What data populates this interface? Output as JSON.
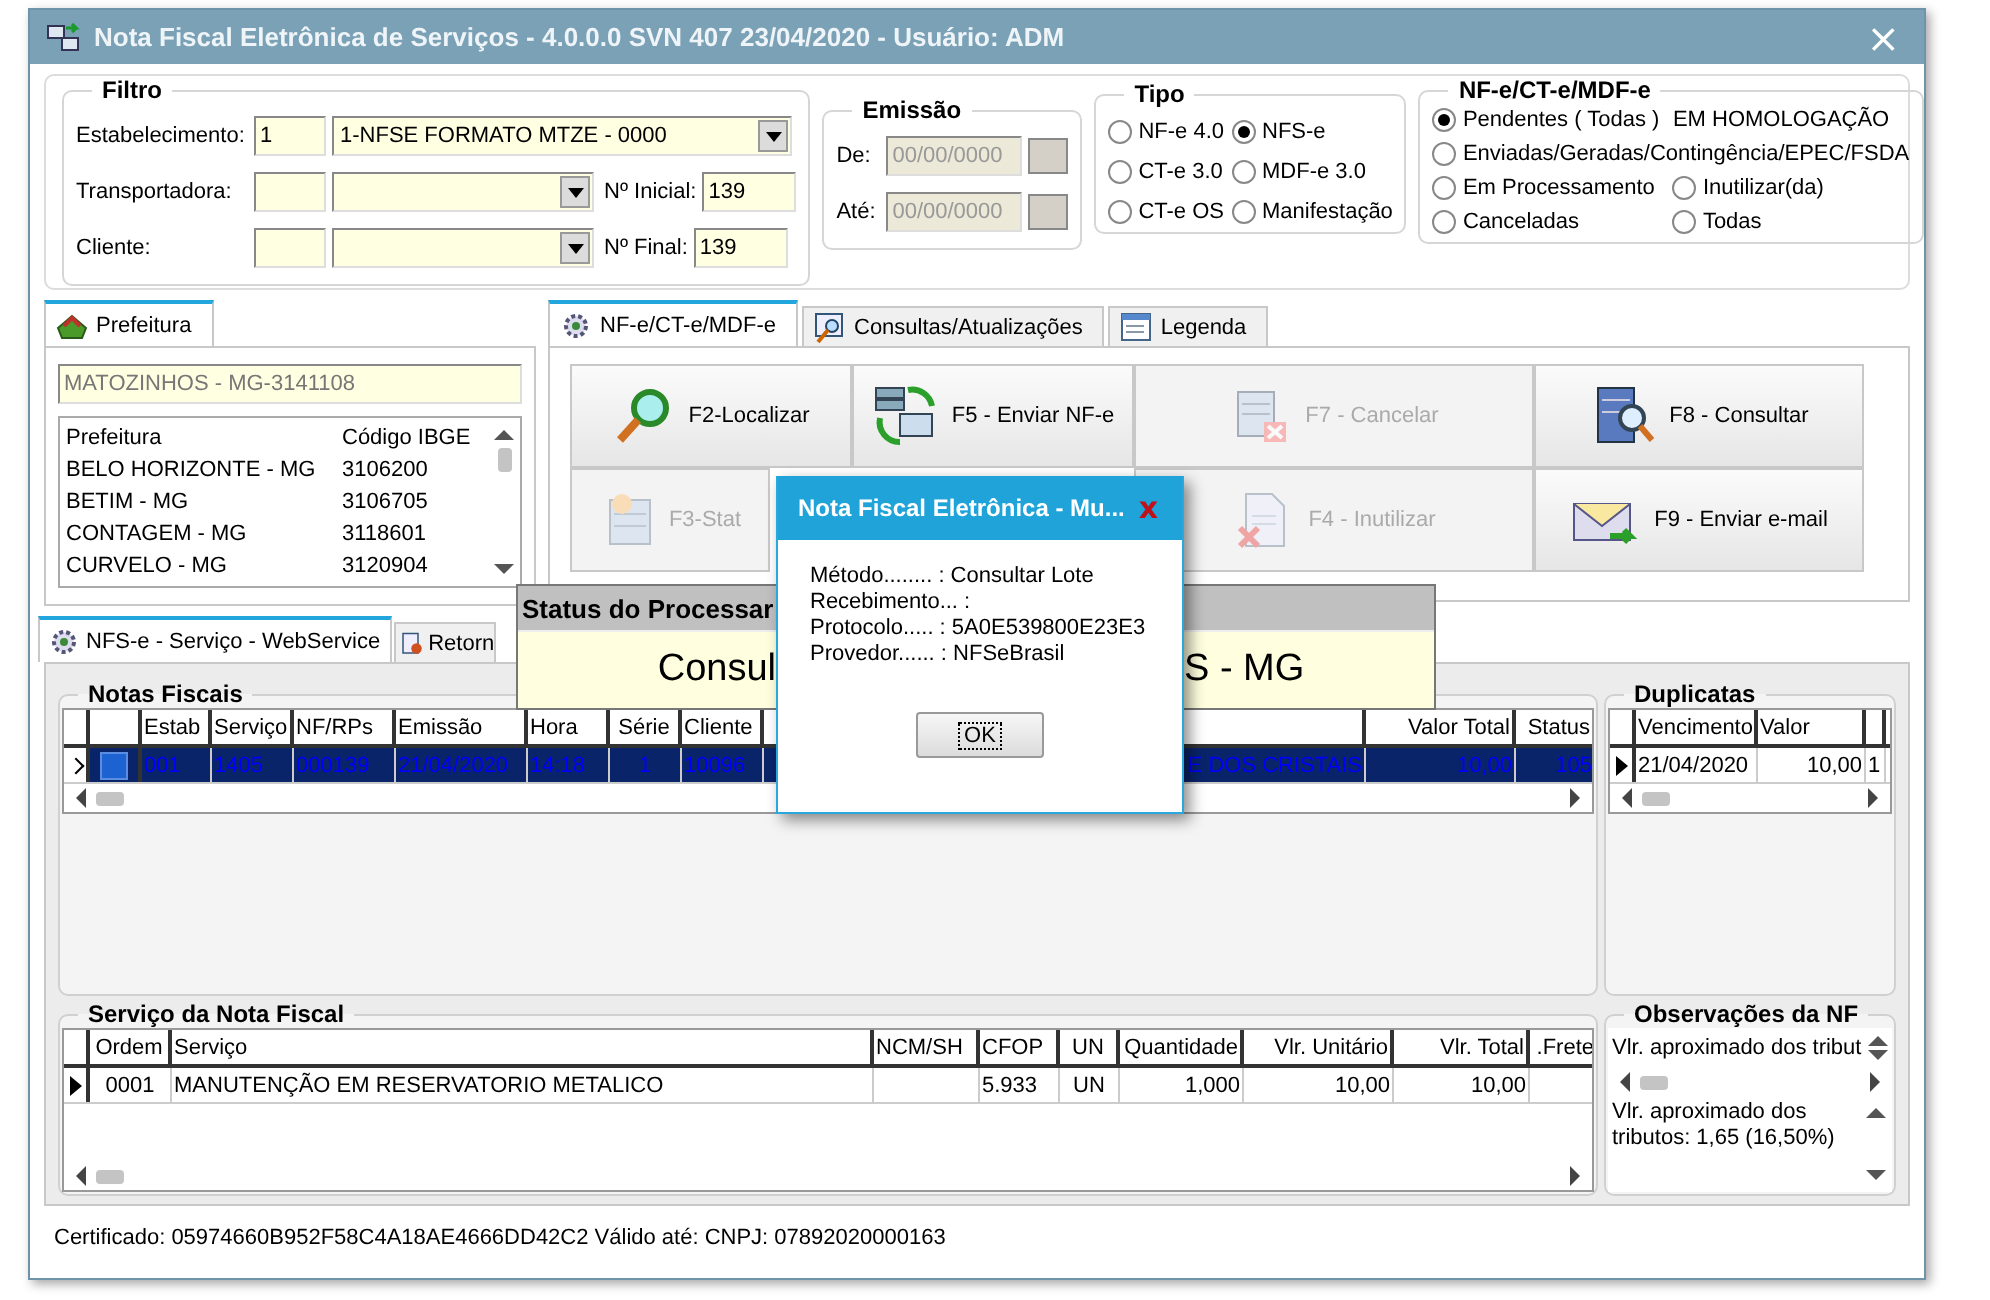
{
  "window": {
    "title": "Nota Fiscal Eletrônica de Serviços - 4.0.0.0 SVN 407 23/04/2020 - Usuário: ADM",
    "close": "×"
  },
  "filter": {
    "title": "Filtro",
    "establishment": {
      "label": "Estabelecimento:",
      "code": "1",
      "value": "1-NFSE FORMATO MTZE - 0000"
    },
    "carrier": {
      "label": "Transportadora:"
    },
    "client": {
      "label": "Cliente:"
    },
    "start_number": {
      "label": "Nº Inicial:",
      "value": "139"
    },
    "end_number": {
      "label": "Nº Final:",
      "value": "139"
    }
  },
  "issue": {
    "title": "Emissão",
    "from": {
      "label": "De:",
      "value": "00/00/0000",
      "disabled": true
    },
    "to": {
      "label": "Até:",
      "value": "00/00/0000",
      "disabled": true
    }
  },
  "type": {
    "title": "Tipo",
    "options": [
      {
        "label": "NF-e 4.0",
        "selected": false
      },
      {
        "label": "NFS-e",
        "selected": true
      },
      {
        "label": "CT-e 3.0",
        "selected": false
      },
      {
        "label": "MDF-e 3.0",
        "selected": false
      },
      {
        "label": "CT-e OS",
        "selected": false
      },
      {
        "label": "Manifestação",
        "selected": false
      }
    ]
  },
  "status_filter": {
    "title": "NF-e/CT-e/MDF-e",
    "note": "EM HOMOLOGAÇÃO",
    "options": [
      {
        "label": "Pendentes ( Todas )",
        "selected": true
      },
      {
        "label": "Enviadas/Geradas/Contingência/EPEC/FSDA",
        "selected": false
      },
      {
        "label": "Em Processamento",
        "selected": false
      },
      {
        "label": "Inutilizar(da)",
        "selected": false
      },
      {
        "label": "Canceladas",
        "selected": false
      },
      {
        "label": "Todas",
        "selected": false
      }
    ]
  },
  "prefeitura": {
    "tab": {
      "label": "Prefeitura",
      "selected": true
    },
    "field": "MATOZINHOS - MG-3141108",
    "columns": [
      "Prefeitura",
      "Código IBGE"
    ],
    "rows": [
      [
        "BELO HORIZONTE - MG",
        "3106200"
      ],
      [
        "BETIM - MG",
        "3106705"
      ],
      [
        "CONTAGEM - MG",
        "3118601"
      ],
      [
        "CURVELO - MG",
        "3120904"
      ]
    ]
  },
  "action_tabs": [
    {
      "label": "NF-e/CT-e/MDF-e",
      "selected": true,
      "kind": "gear"
    },
    {
      "label": "Consultas/Atualizações",
      "selected": false,
      "kind": "search"
    },
    {
      "label": "Legenda",
      "selected": false,
      "kind": "window"
    }
  ],
  "actions": {
    "rows": [
      [
        {
          "label": "F2-Localizar",
          "kind": "find",
          "disabled": false
        },
        {
          "label": "F5 - Enviar NF-e",
          "kind": "send",
          "disabled": false
        },
        {
          "label": "F7 - Cancelar",
          "kind": "cancel",
          "disabled": true
        },
        {
          "label": "F8 - Consultar",
          "kind": "query",
          "disabled": false
        }
      ],
      [
        {
          "label": "F3-Stat",
          "kind": "status",
          "disabled": true
        },
        "",
        {
          "label": "F4 - Inutilizar",
          "kind": "void",
          "disabled": true
        },
        {
          "label": "F9 - Enviar e-mail",
          "kind": "email",
          "disabled": false
        }
      ]
    ]
  },
  "bottom_tabs": [
    {
      "label": "NFS-e - Serviço - WebService",
      "selected": true,
      "kind": "gear"
    },
    {
      "label": "Retorn",
      "selected": false,
      "kind": "doc"
    }
  ],
  "notes": {
    "title": "Notas Fiscais",
    "columns": [
      "Estab",
      "Serviço",
      "NF/RPs",
      "Emissão",
      "Hora",
      "Série",
      "Cliente",
      "",
      "Valor Total",
      "Status"
    ],
    "rows": [
      {
        "selected": true,
        "cells": [
          "001",
          "1405",
          "000139",
          "21/04/2020",
          "14:18",
          "1",
          "10096",
          "E DOS CRISTAIS",
          "10,00",
          "105"
        ]
      }
    ]
  },
  "services": {
    "title": "Serviço da Nota Fiscal",
    "columns": [
      "Ordem",
      "Serviço",
      "NCM/SH",
      "CFOP",
      "UN",
      "Quantidade",
      "Vlr. Unitário",
      "Vlr. Total",
      ".Frete"
    ],
    "rows": [
      [
        "0001",
        "MANUTENÇÃO EM RESERVATORIO METALICO",
        null,
        "5.933",
        "UN",
        "1,000",
        "10,00",
        "10,00",
        null
      ]
    ]
  },
  "installments": {
    "title": "Duplicatas",
    "columns": [
      "Vencimento",
      "Valor"
    ],
    "rows": [
      [
        "21/04/2020",
        "10,00",
        "1"
      ]
    ]
  },
  "observations": {
    "title": "Observações da NF",
    "field": "Vlr. aproximado dos tribut",
    "memo": "Vlr. aproximado dos tributos: 1,65 (16,50%)"
  },
  "status_bar": "Certificado: 05974660B952F58C4A18AE4666DD42C2 Válido até:  CNPJ: 07892020000163",
  "processing": {
    "title": "Status do Processar",
    "message_start": "Consul",
    "message_end": "S - MG"
  },
  "dialog": {
    "title": "Nota Fiscal Eletrônica - Mu...",
    "close": "x",
    "lines": [
      "Método........ : Consultar Lote",
      "Recebimento... :",
      "Protocolo..... : 5A0E539800E23E3",
      "Provedor...... : NFSeBrasil"
    ],
    "button": "OK"
  }
}
